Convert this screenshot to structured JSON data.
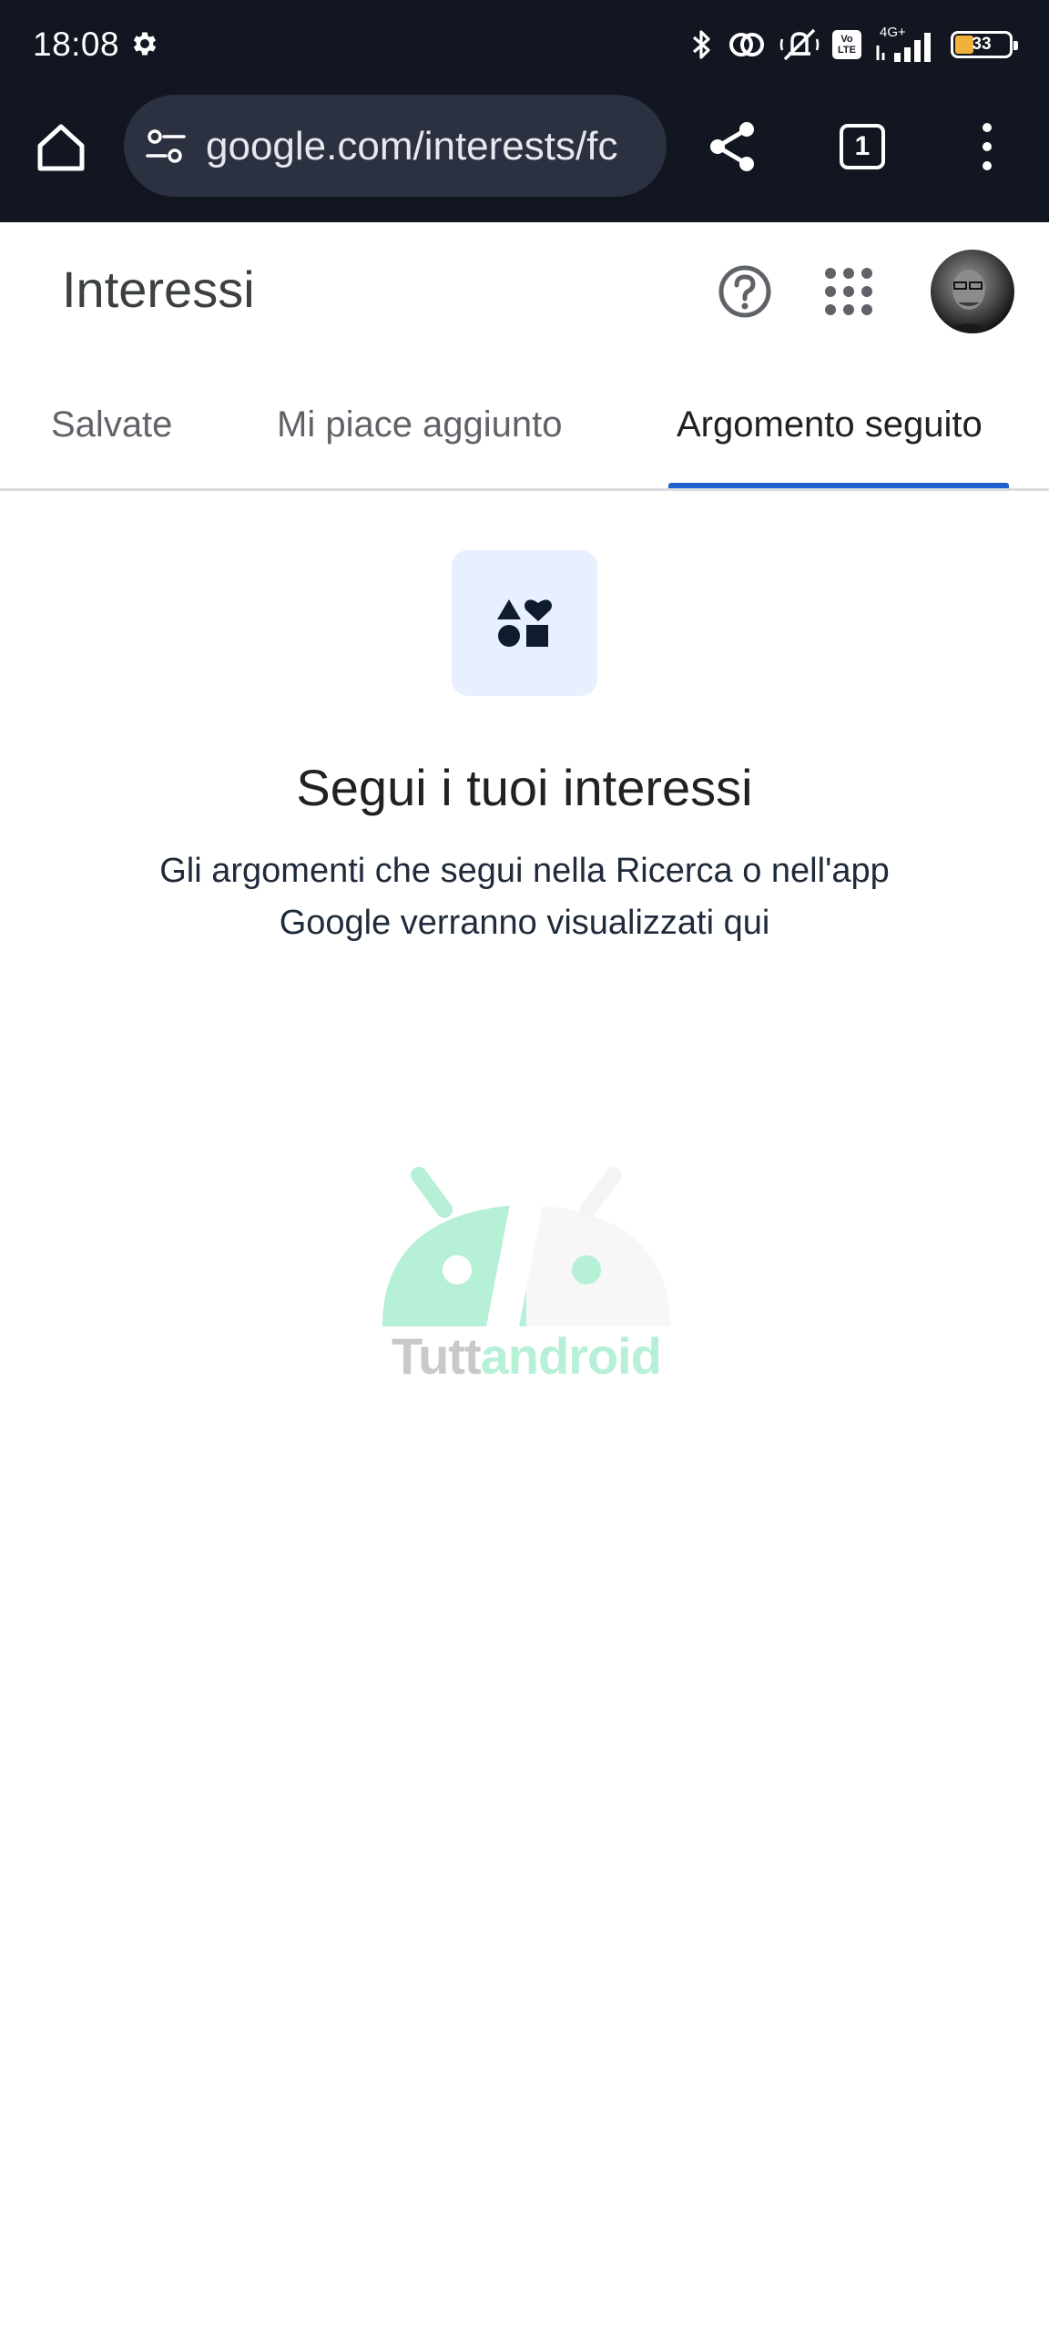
{
  "status_bar": {
    "time": "18:08",
    "network": "4G+",
    "volte": "Vo LTE",
    "battery_percent": "33",
    "icons": [
      "gear-icon",
      "bluetooth-icon",
      "hotspot-icon",
      "vibrate-off-icon",
      "volte-icon",
      "signal-icon",
      "battery-icon"
    ]
  },
  "browser": {
    "url": "google.com/interests/fc",
    "tab_count": "1",
    "icons": [
      "home-icon",
      "site-settings-icon",
      "share-icon",
      "tab-switcher-icon",
      "more-menu-icon"
    ]
  },
  "header": {
    "title": "Interessi",
    "icons": [
      "help-icon",
      "apps-grid-icon",
      "avatar"
    ]
  },
  "tabs": [
    {
      "label": "Salvate",
      "active": false
    },
    {
      "label": "Mi piace aggiunto",
      "active": false
    },
    {
      "label": "Argomento seguito",
      "active": true
    }
  ],
  "empty_state": {
    "icon": "interests-shapes-icon",
    "title": "Segui i tuoi interessi",
    "description": "Gli argomenti che segui nella Ricerca o nell'app Google verranno visualizzati qui"
  },
  "watermark": {
    "text_part1": "Tutt",
    "text_part2": "android"
  },
  "colors": {
    "toolbar_bg": "#121621",
    "urlbar_bg": "#2b3140",
    "tab_indicator": "#1f5fcf",
    "icon_box_bg": "#e8efff",
    "icon_color": "#0f1c2e"
  }
}
